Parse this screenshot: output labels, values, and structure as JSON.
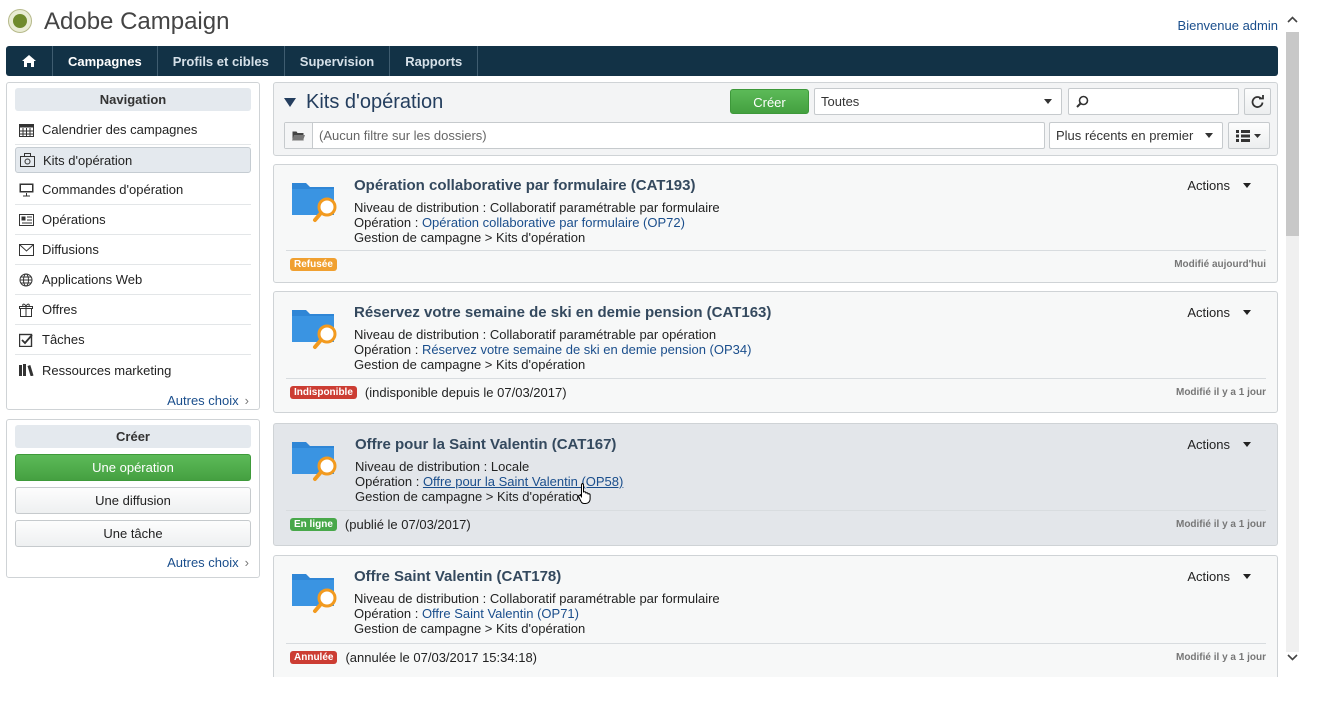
{
  "header": {
    "app_title": "Adobe Campaign",
    "welcome": "Bienvenue admin"
  },
  "topnav": {
    "items": [
      "Campagnes",
      "Profils et cibles",
      "Supervision",
      "Rapports"
    ],
    "active": "Campagnes"
  },
  "sidebar": {
    "navigation": {
      "title": "Navigation",
      "items": [
        {
          "label": "Calendrier des campagnes",
          "icon": "calendar-icon"
        },
        {
          "label": "Kits d'opération",
          "icon": "kit-icon",
          "selected": true
        },
        {
          "label": "Commandes d'opération",
          "icon": "presentation-icon"
        },
        {
          "label": "Opérations",
          "icon": "operations-icon"
        },
        {
          "label": "Diffusions",
          "icon": "envelope-icon"
        },
        {
          "label": "Applications Web",
          "icon": "globe-icon"
        },
        {
          "label": "Offres",
          "icon": "gift-icon"
        },
        {
          "label": "Tâches",
          "icon": "checkbox-icon"
        },
        {
          "label": "Ressources marketing",
          "icon": "books-icon"
        }
      ],
      "more": "Autres choix"
    },
    "create": {
      "title": "Créer",
      "buttons": [
        "Une opération",
        "Une diffusion",
        "Une tâche"
      ],
      "more": "Autres choix"
    }
  },
  "main": {
    "title": "Kits d'opération",
    "create_label": "Créer",
    "filter_select": "Toutes",
    "search_value": "",
    "folder_filter": "(Aucun filtre sur les dossiers)",
    "sort": "Plus récents en premier"
  },
  "cards": [
    {
      "title": "Opération collaborative par formulaire (CAT193)",
      "distribution_label": "Niveau de distribution",
      "distribution": "Collaboratif paramétrable par formulaire",
      "operation_label": "Opération",
      "operation": "Opération collaborative par formulaire (OP72)",
      "path": "Gestion de campagne > Kits d'opération",
      "actions": "Actions",
      "badge": "Refusée",
      "badge_color": "#f0a030",
      "note": "",
      "modified": "Modifié aujourd'hui"
    },
    {
      "title": "Réservez votre semaine de ski en demie pension (CAT163)",
      "distribution_label": "Niveau de distribution",
      "distribution": "Collaboratif paramétrable par opération",
      "operation_label": "Opération",
      "operation": "Réservez votre semaine de ski en demie pension (OP34)",
      "path": "Gestion de campagne > Kits d'opération",
      "actions": "Actions",
      "badge": "Indisponible",
      "badge_color": "#cc3d33",
      "note": "(indisponible depuis le 07/03/2017)",
      "modified": "Modifié il y a 1 jour"
    },
    {
      "title": "Offre pour la Saint Valentin (CAT167)",
      "distribution_label": "Niveau de distribution",
      "distribution": "Locale",
      "operation_label": "Opération",
      "operation": "Offre pour la Saint Valentin (OP58)",
      "path": "Gestion de campagne > Kits d'opération",
      "actions": "Actions",
      "badge": "En ligne",
      "badge_color": "#48a84a",
      "note": "(publié le 07/03/2017)",
      "modified": "Modifié il y a 1 jour"
    },
    {
      "title": "Offre Saint Valentin (CAT178)",
      "distribution_label": "Niveau de distribution",
      "distribution": "Collaboratif paramétrable par formulaire",
      "operation_label": "Opération",
      "operation": "Offre Saint Valentin (OP71)",
      "path": "Gestion de campagne > Kits d'opération",
      "actions": "Actions",
      "badge": "Annulée",
      "badge_color": "#cc3d33",
      "note": "(annulée le 07/03/2017 15:34:18)",
      "modified": "Modifié il y a 1 jour"
    }
  ],
  "colors": {
    "nav_bg": "#123246",
    "accent_green": "#48a84a",
    "link": "#1a4e8c",
    "folder_blue": "#2f86d6",
    "magnifier_orange": "#f29a1f"
  }
}
